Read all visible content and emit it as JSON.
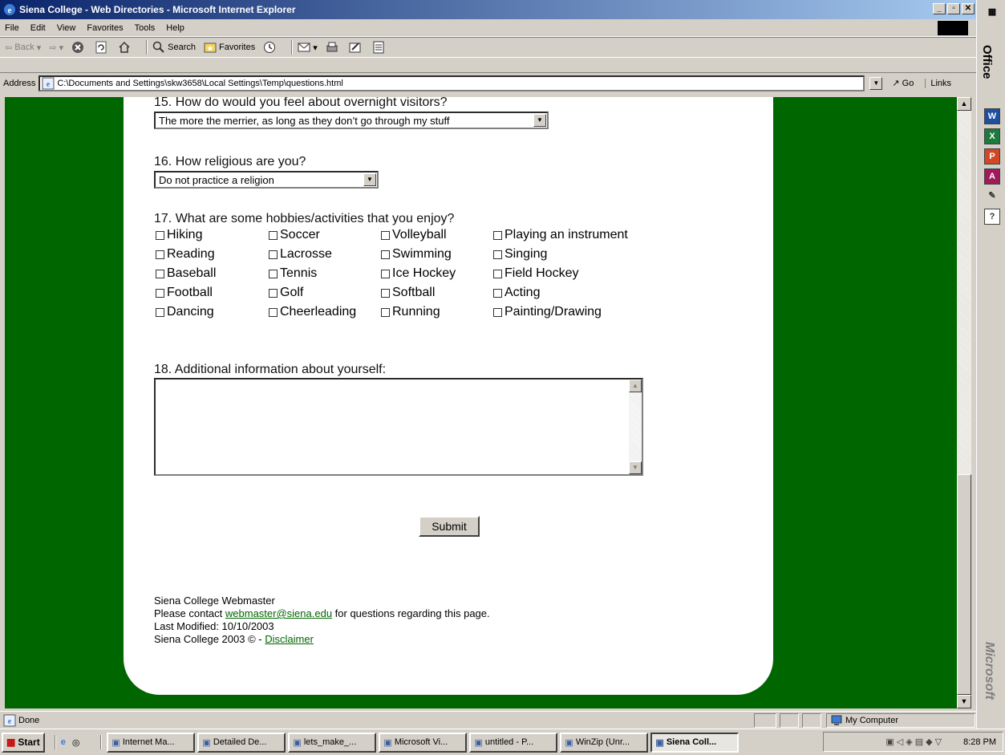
{
  "window": {
    "title": "Siena College - Web Directories - Microsoft Internet Explorer",
    "min_btn": "_",
    "max_btn": "▫",
    "close_btn": "✕"
  },
  "menu": [
    "File",
    "Edit",
    "View",
    "Favorites",
    "Tools",
    "Help"
  ],
  "toolbar": {
    "back": "Back",
    "search": "Search",
    "favorites": "Favorites"
  },
  "address": {
    "label": "Address",
    "url": "C:\\Documents and Settings\\skw3658\\Local Settings\\Temp\\questions.html",
    "go": "Go",
    "links": "Links"
  },
  "form": {
    "q15": "15. How do would you feel about overnight visitors?",
    "q15_value": "The more the merrier, as long as they don’t go through my stuff",
    "q16": "16. How religious are you?",
    "q16_value": "Do not practice a religion",
    "q17": "17. What are some hobbies/activities that you enjoy?",
    "hobbies": [
      [
        "Hiking",
        "Soccer",
        "Volleyball",
        "Playing an instrument"
      ],
      [
        "Reading",
        "Lacrosse",
        "Swimming",
        "Singing"
      ],
      [
        "Baseball",
        "Tennis",
        "Ice Hockey",
        "Field Hockey"
      ],
      [
        "Football",
        "Golf",
        "Softball",
        "Acting"
      ],
      [
        "Dancing",
        "Cheerleading",
        "Running",
        "Painting/Drawing"
      ]
    ],
    "q18": "18. Additional information about yourself:",
    "submit": "Submit"
  },
  "footer": {
    "line1": "Siena College Webmaster",
    "line2_pre": "Please contact ",
    "email": "webmaster@siena.edu",
    "line2_post": " for questions regarding this page.",
    "line3": "Last Modified: 10/10/2003",
    "line4_pre": "Siena College 2003 © - ",
    "disclaimer": "Disclaimer"
  },
  "status": {
    "text": "Done",
    "zone": "My Computer"
  },
  "taskbar": {
    "start": "Start",
    "tasks": [
      "Internet Ma...",
      "Detailed De...",
      "lets_make_...",
      "Microsoft Vi...",
      "untitled - P...",
      "WinZip (Unr...",
      "Siena Coll..."
    ],
    "clock": "8:28 PM"
  },
  "officebar": {
    "label": "Office",
    "brand": "Microsoft"
  },
  "colors": {
    "page_bg": "#006600",
    "link": "#006600",
    "titlebar_start": "#0a246a"
  }
}
